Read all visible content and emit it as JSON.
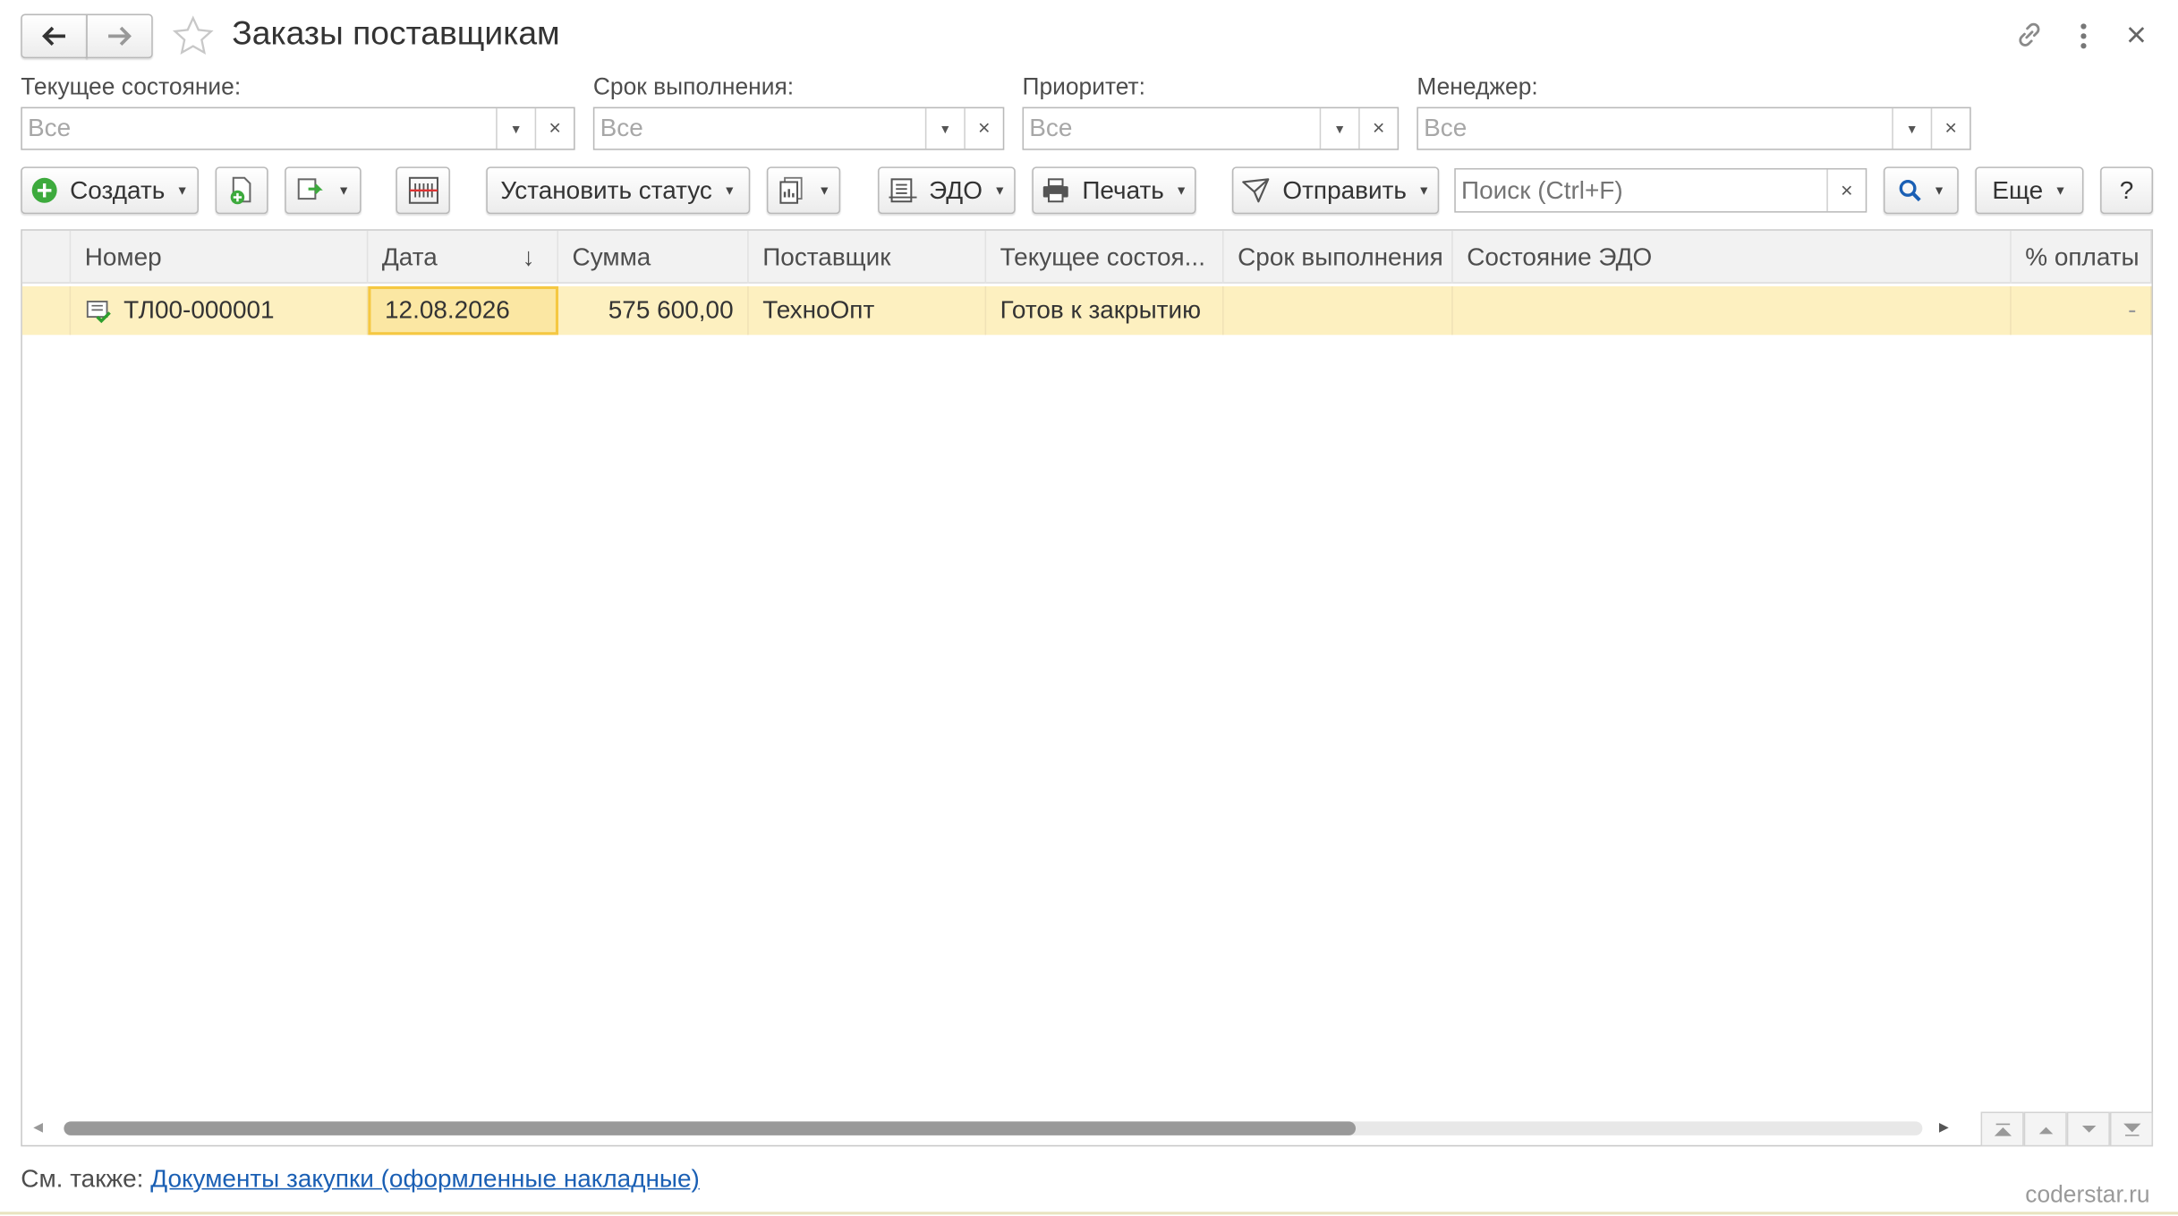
{
  "window": {
    "title": "Заказы поставщикам",
    "back_icon": "arrow-left-icon",
    "forward_icon": "arrow-right-icon",
    "favorite_icon": "star-icon",
    "link_icon": "link-icon",
    "menu_icon": "more-vertical-icon",
    "close_icon": "close-icon"
  },
  "filters": {
    "state": {
      "label": "Текущее состояние:",
      "value": "Все"
    },
    "deadline": {
      "label": "Срок выполнения:",
      "value": "Все"
    },
    "priority": {
      "label": "Приоритет:",
      "value": "Все"
    },
    "manager": {
      "label": "Менеджер:",
      "value": "Все"
    }
  },
  "toolbar": {
    "create_label": "Создать",
    "set_status_label": "Установить статус",
    "edo_label": "ЭДО",
    "print_label": "Печать",
    "send_label": "Отправить",
    "search_placeholder": "Поиск (Ctrl+F)",
    "more_label": "Еще",
    "help_label": "?"
  },
  "table": {
    "columns": [
      "Номер",
      "Дата",
      "Сумма",
      "Поставщик",
      "Текущее состоя...",
      "Срок выполнения",
      "Состояние ЭДО",
      "% оплаты"
    ],
    "sort_indicator": "↓",
    "rows": [
      {
        "number": "ТЛ00-000001",
        "date": "12.08.2026",
        "sum": "575 600,00",
        "supplier": "ТехноОпт",
        "state": "Готов к закрытию",
        "deadline": "",
        "edo_state": "",
        "payment": "-"
      }
    ]
  },
  "scrollbar": {
    "position_fraction": 0.0,
    "visible_fraction": 0.69
  },
  "footer": {
    "see_also_label": "См. также:",
    "see_also_link": "Документы закупки (оформленные накладные)"
  },
  "watermark": "coderstar.ru",
  "colors": {
    "selected_row": "#fdf0c0",
    "selected_cell_border": "#f5c842",
    "link": "#1a5fb4",
    "create_icon": "#3daa3d"
  }
}
